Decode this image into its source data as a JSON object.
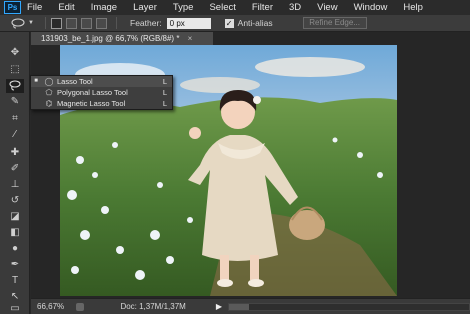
{
  "app": {
    "logo": "Ps"
  },
  "menu": [
    "File",
    "Edit",
    "Image",
    "Layer",
    "Type",
    "Select",
    "Filter",
    "3D",
    "View",
    "Window",
    "Help"
  ],
  "options": {
    "tool_icon": "lasso-icon",
    "feather_label": "Feather:",
    "feather_value": "0 px",
    "antialias_label": "Anti-alias",
    "antialias_checked": true,
    "refine_edge_label": "Refine Edge..."
  },
  "document": {
    "tab_title": "131903_be_1.jpg @ 66,7% (RGB/8#) *",
    "zoom": "66,67%",
    "doc_info": "Doc: 1,37M/1,37M"
  },
  "flyout": {
    "items": [
      {
        "label": "Lasso Tool",
        "key": "L",
        "selected": true
      },
      {
        "label": "Polygonal Lasso Tool",
        "key": "L",
        "selected": false
      },
      {
        "label": "Magnetic Lasso Tool",
        "key": "L",
        "selected": false
      }
    ]
  },
  "colors": {
    "accent": "#31a8ff",
    "panel": "#3a3a3a",
    "menubar": "#2b2b2b"
  }
}
